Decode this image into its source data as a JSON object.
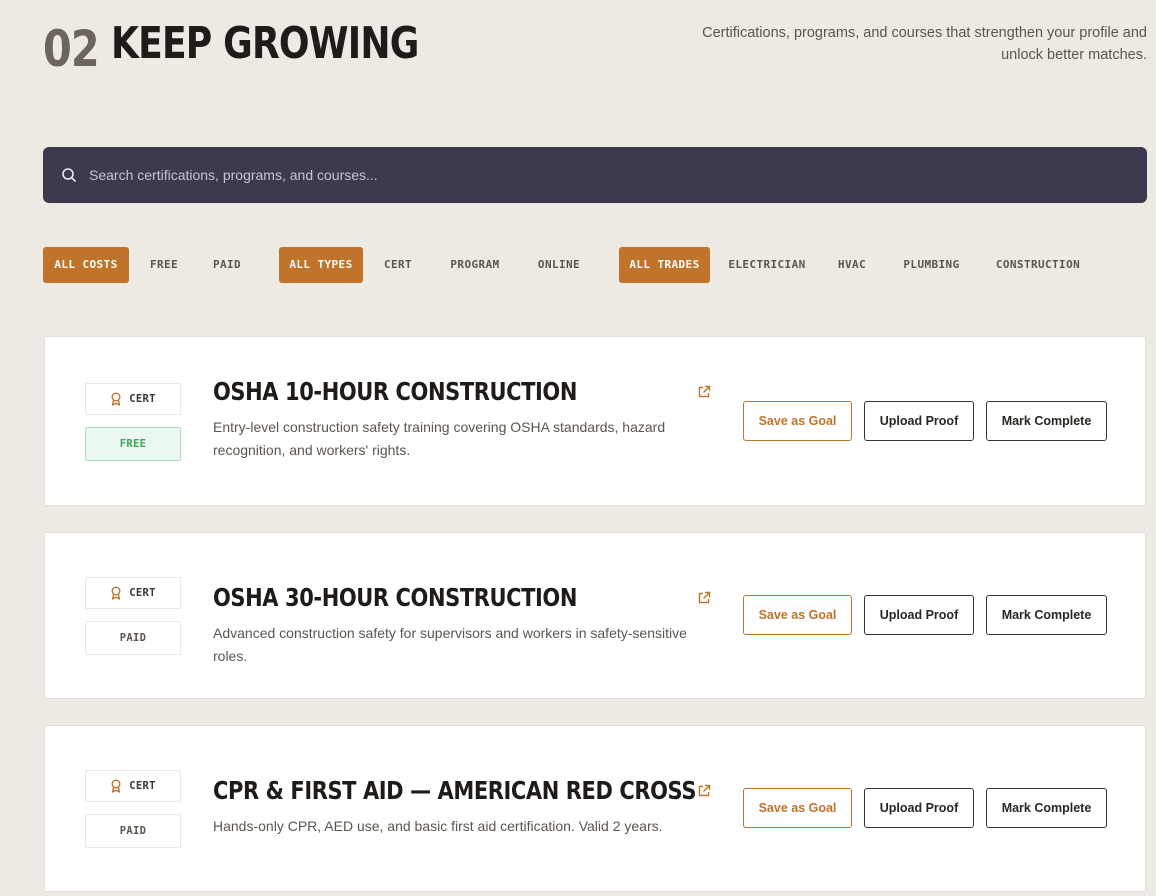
{
  "header": {
    "number": "02",
    "title": "KEEP GROWING",
    "description": "Certifications, programs, and courses that strengthen your profile and unlock better matches."
  },
  "search": {
    "placeholder": "Search certifications, programs, and courses..."
  },
  "filters": {
    "cost": [
      "ALL COSTS",
      "FREE",
      "PAID"
    ],
    "type": [
      "ALL TYPES",
      "CERT",
      "PROGRAM",
      "ONLINE"
    ],
    "trade": [
      "ALL TRADES",
      "ELECTRICIAN",
      "HVAC",
      "PLUMBING",
      "CONSTRUCTION"
    ]
  },
  "buttons": {
    "save": "Save as Goal",
    "upload": "Upload Proof",
    "complete": "Mark Complete"
  },
  "courses": [
    {
      "type": "CERT",
      "cost": "FREE",
      "title": "OSHA 10-HOUR CONSTRUCTION",
      "description": "Entry-level construction safety training covering OSHA standards, hazard recognition, and workers' rights."
    },
    {
      "type": "CERT",
      "cost": "PAID",
      "title": "OSHA 30-HOUR CONSTRUCTION",
      "description": "Advanced construction safety for supervisors and workers in safety-sensitive roles."
    },
    {
      "type": "CERT",
      "cost": "PAID",
      "title": "CPR & FIRST AID — AMERICAN RED CROSS",
      "description": "Hands-only CPR, AED use, and basic first aid certification. Valid 2 years."
    }
  ],
  "colors": {
    "accent": "#c0732a",
    "search_bg": "#3d3a4f",
    "page_bg": "#ede9e3",
    "free_green": "#3fa65f"
  },
  "icons": {
    "search": "search-icon",
    "cert": "award-icon",
    "link": "external-link-icon"
  }
}
